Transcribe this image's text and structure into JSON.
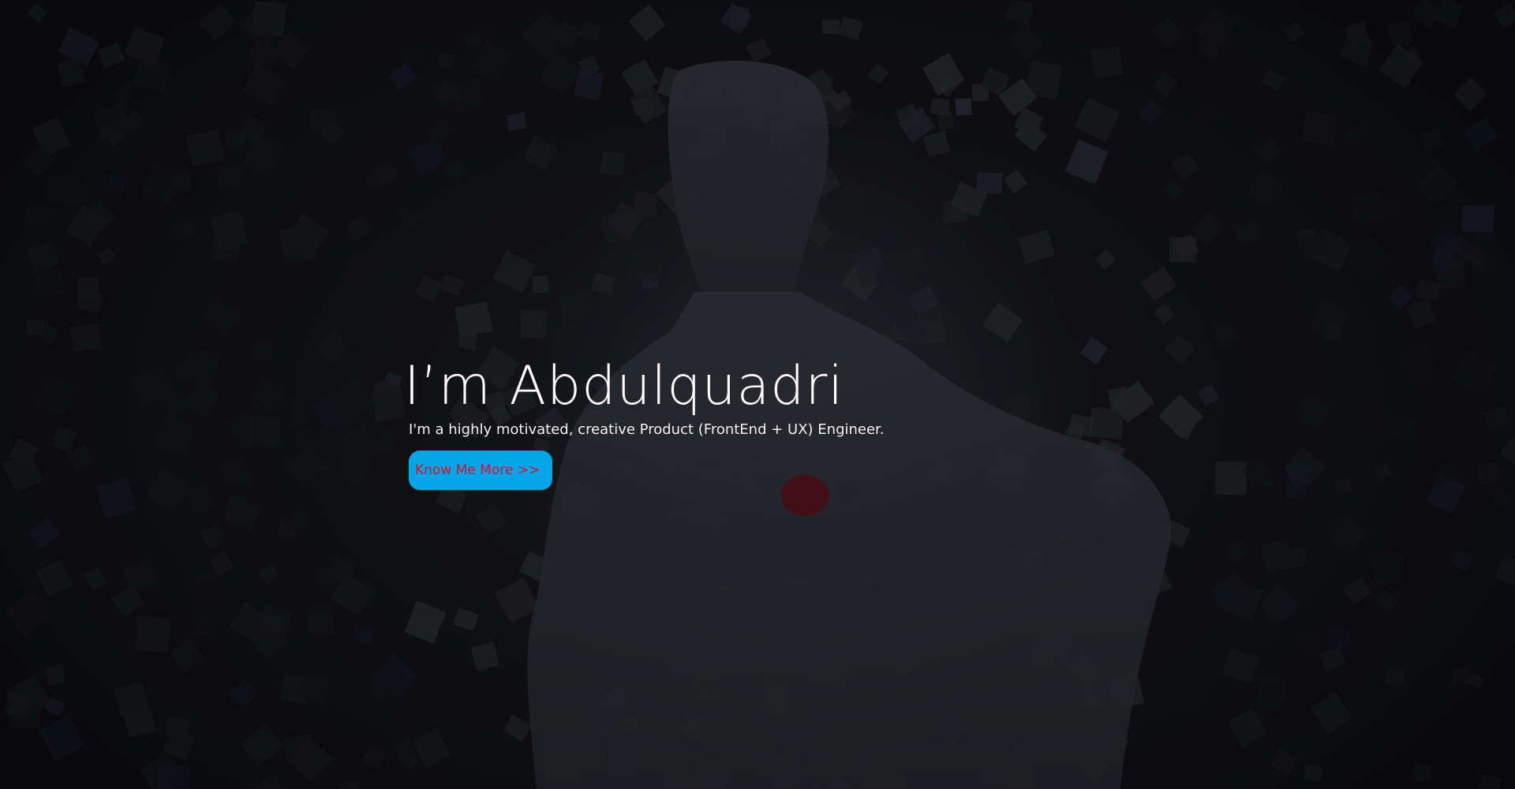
{
  "hero": {
    "headline": "I’m Abdulquadri",
    "tagline": "I'm a highly motivated, creative Product (FrontEnd + UX) Engineer.",
    "cta_label": "Know Me More >>"
  },
  "colors": {
    "cta_background": "#00a6e8",
    "cta_text": "#d1142f",
    "headline_text": "#ffffff",
    "page_background": "#0e0f12"
  }
}
